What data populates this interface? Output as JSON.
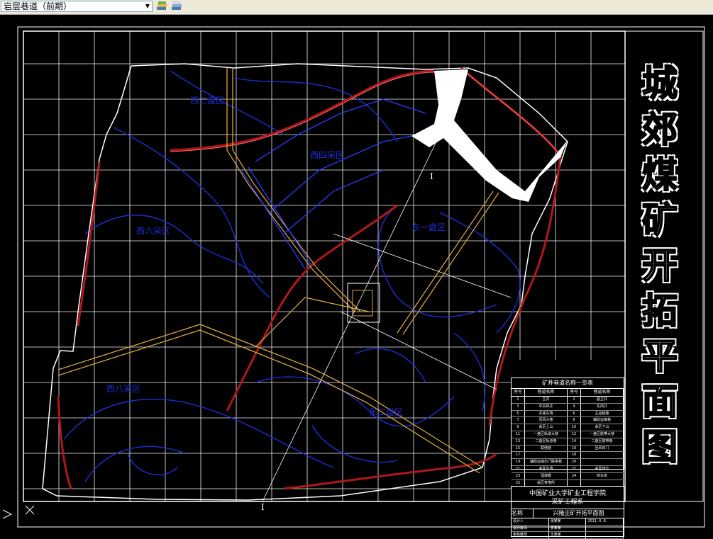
{
  "toolbar": {
    "layer_name": "岩层巷道（前期）",
    "dropdown_icon": "chevron-down-icon",
    "layer_icons": [
      "layer-states-icon",
      "layer-previous-icon"
    ]
  },
  "drawing": {
    "title_chars": [
      "城",
      "郊",
      "煤",
      "矿",
      "开",
      "拓",
      "平",
      "面",
      "图"
    ],
    "zones": {
      "west_two": "西二盘区",
      "west_four": "西四采区",
      "west_six": "西六采区",
      "east_one": "东一盘区",
      "west_eight": "西八采区",
      "east_two": "东二盘区"
    },
    "section_marks": [
      "I",
      "I"
    ],
    "colors": {
      "background": "#000000",
      "grid": "#ffffff",
      "contour": "#1c2ed6",
      "roadway": "#b01818",
      "shaft": "#d9a441"
    }
  },
  "legend_table": {
    "title": "矿井巷道名称一览表",
    "headers": [
      "序号",
      "巷道名称",
      "序号",
      "巷道名称"
    ],
    "rows": [
      [
        "1",
        "主井",
        "2",
        "副立井"
      ],
      [
        "3",
        "中央风井",
        "4",
        "东风井"
      ],
      [
        "5",
        "井底车场",
        "6",
        "主运输巷"
      ],
      [
        "7",
        "回风大巷",
        "8",
        "辅助运输巷"
      ],
      [
        "9",
        "采区上山",
        "10",
        "采区下山"
      ],
      [
        "11",
        "一盘区轨道大巷",
        "12",
        "一盘区胶带大巷"
      ],
      [
        "13",
        "二盘区轨道巷",
        "14",
        "二盘区胶带巷"
      ],
      [
        "15",
        "联络巷",
        "16",
        "回风石门"
      ],
      [
        "17",
        "",
        "18",
        ""
      ],
      [
        "19",
        "辅助运输石门联络巷",
        "20",
        ""
      ],
      [
        "21",
        "采区车场",
        "22",
        "采区煤仓"
      ],
      [
        "23",
        "溜煤眼",
        "24",
        "绞车房"
      ],
      [
        "25",
        "采区变电所",
        "",
        ""
      ]
    ]
  },
  "title_block": {
    "org_line1": "中国矿业大学矿业工程学院",
    "org_line2": "采矿工程系",
    "drawing_label": "名称",
    "drawing_name": "兴隆庄矿开拓平面图",
    "signatures": [
      [
        "设计人",
        "张某某",
        "2011. 6. 8"
      ],
      [
        "指导教师",
        "李某某",
        ""
      ],
      [
        "审核教师",
        "王某某",
        ""
      ]
    ]
  }
}
